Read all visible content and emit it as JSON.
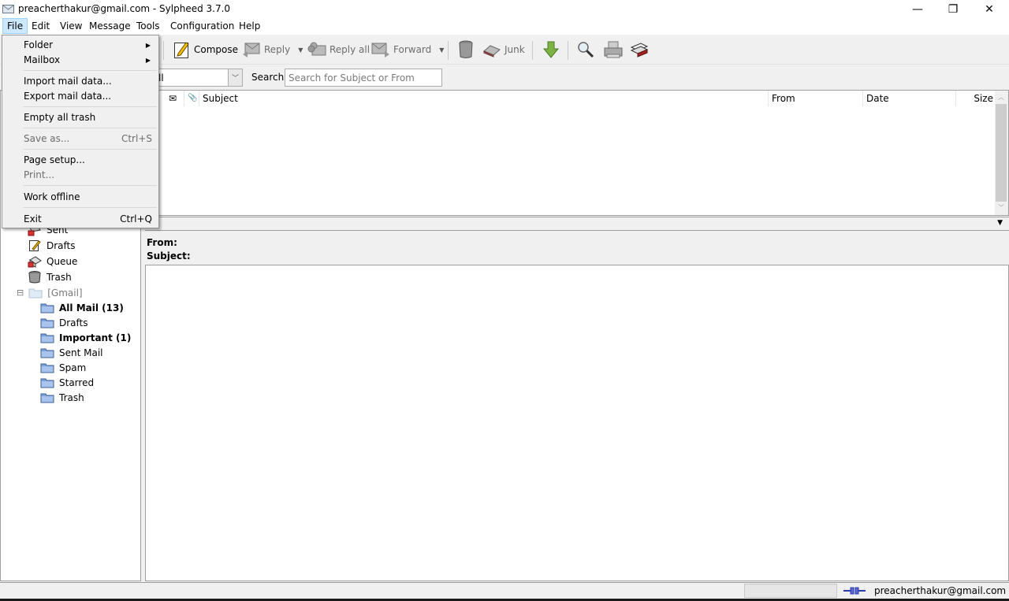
{
  "window": {
    "title": "preacherthakur@gmail.com - Sylpheed 3.7.0",
    "controls": {
      "minimize": "—",
      "restore": "❐",
      "close": "✕"
    }
  },
  "menubar": {
    "items": [
      {
        "label": "File",
        "active": true
      },
      {
        "label": "Edit"
      },
      {
        "label": "View"
      },
      {
        "label": "Message"
      },
      {
        "label": "Tools"
      },
      {
        "label": "Configuration"
      },
      {
        "label": "Help"
      }
    ]
  },
  "file_menu": {
    "items": [
      {
        "label": "Folder",
        "submenu": true
      },
      {
        "label": "Mailbox",
        "submenu": true
      },
      {
        "label": "Import mail data..."
      },
      {
        "label": "Export mail data..."
      },
      {
        "label": "Empty all trash"
      },
      {
        "label": "Save as...",
        "shortcut": "Ctrl+S",
        "disabled": true
      },
      {
        "label": "Page setup..."
      },
      {
        "label": "Print...",
        "disabled": true
      },
      {
        "label": "Work offline"
      },
      {
        "label": "Exit",
        "shortcut": "Ctrl+Q"
      }
    ],
    "submenu_arrow": "▶"
  },
  "toolbar": {
    "compose": "Compose",
    "reply": "Reply",
    "reply_all": "Reply all",
    "forward": "Forward",
    "junk": "Junk",
    "dropdown_arrow": "▼"
  },
  "search": {
    "filter_value": "ll",
    "filter_arrow": "﹀",
    "label": "Search:",
    "placeholder": "Search for Subject or From",
    "value": ""
  },
  "folders": {
    "local": [
      {
        "label": "Sent",
        "icon": "sent-icon"
      },
      {
        "label": "Drafts",
        "icon": "drafts-icon"
      },
      {
        "label": "Queue",
        "icon": "queue-icon"
      },
      {
        "label": "Trash",
        "icon": "trash-icon"
      }
    ],
    "gmail_group": {
      "label": "[Gmail]",
      "expander": "⊟"
    },
    "gmail": [
      {
        "label": "All Mail (13)",
        "bold": true
      },
      {
        "label": "Drafts"
      },
      {
        "label": "Important (1)",
        "bold": true
      },
      {
        "label": "Sent Mail"
      },
      {
        "label": "Spam"
      },
      {
        "label": "Starred"
      },
      {
        "label": "Trash"
      }
    ]
  },
  "message_list": {
    "columns": {
      "mark": "✉",
      "attach": "📎",
      "subject": "Subject",
      "from": "From",
      "date": "Date",
      "size": "Size"
    },
    "rows": []
  },
  "preview": {
    "toggle": "▼",
    "from_label": "From:",
    "subject_label": "Subject:"
  },
  "statusbar": {
    "account": "preacherthakur@gmail.com"
  }
}
